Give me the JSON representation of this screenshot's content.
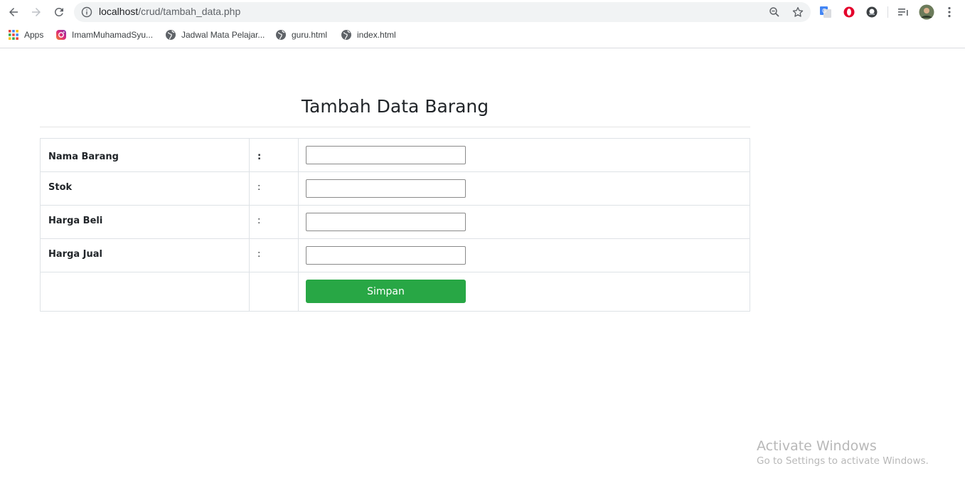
{
  "browser": {
    "url_host": "localhost",
    "url_path": "/crud/tambah_data.php",
    "bookmarks": [
      {
        "label": "Apps",
        "icon": "apps-grid-icon"
      },
      {
        "label": "ImamMuhamadSyu...",
        "icon": "instagram-icon"
      },
      {
        "label": "Jadwal Mata Pelajar...",
        "icon": "globe-icon"
      },
      {
        "label": "guru.html",
        "icon": "globe-icon"
      },
      {
        "label": "index.html",
        "icon": "globe-icon"
      }
    ]
  },
  "page": {
    "title": "Tambah Data Barang",
    "form": {
      "rows": [
        {
          "label": "Nama Barang",
          "colon": ":",
          "value": ""
        },
        {
          "label": "Stok",
          "colon": ":",
          "value": ""
        },
        {
          "label": "Harga Beli",
          "colon": ":",
          "value": ""
        },
        {
          "label": "Harga Jual",
          "colon": ":",
          "value": ""
        }
      ],
      "submit_label": "Simpan"
    }
  },
  "watermark": {
    "title": "Activate Windows",
    "subtitle": "Go to Settings to activate Windows."
  },
  "colors": {
    "submit_button": "#28a745",
    "border": "#dee2e6",
    "text": "#212529"
  }
}
